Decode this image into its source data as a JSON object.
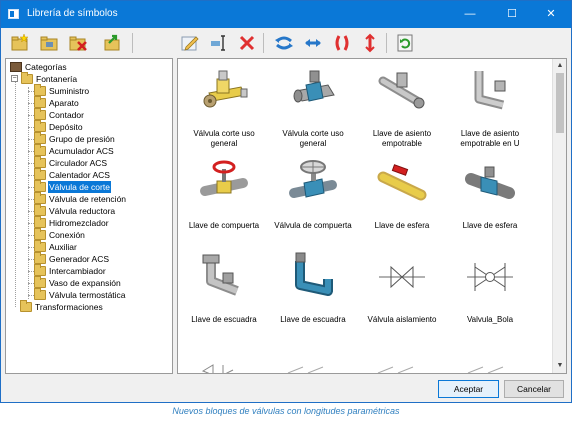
{
  "window": {
    "title": "Librería de símbolos",
    "controls": {
      "minimize": "—",
      "maximize": "☐",
      "close": "✕"
    }
  },
  "toolbar": {
    "buttons": [
      "new-folder-icon",
      "folder-icon",
      "delete-folder-icon",
      "export-icon",
      "edit-icon",
      "rename-icon",
      "delete-icon",
      "rotate-left-icon",
      "rotate-right-icon",
      "flip-vertical-icon",
      "flip-horizontal-icon",
      "refresh-icon"
    ]
  },
  "tree": {
    "root": "Categorías",
    "group": "Fontanería",
    "items": [
      "Suministro",
      "Aparato",
      "Contador",
      "Depósito",
      "Grupo de presión",
      "Acumulador ACS",
      "Circulador ACS",
      "Calentador ACS",
      "Válvula de corte",
      "Válvula de retención",
      "Válvula reductora",
      "Hidromezclador",
      "Conexión",
      "Auxiliar",
      "Generador ACS",
      "Intercambiador",
      "Vaso de expansión",
      "Válvula termostática"
    ],
    "selected": "Válvula de corte",
    "other": "Transformaciones"
  },
  "symbols": [
    {
      "label": "Válvula corte uso general",
      "icon": "gate-valve-yellow-icon"
    },
    {
      "label": "Válvula corte uso general",
      "icon": "gate-valve-blue-icon"
    },
    {
      "label": "Llave de asiento empotrable",
      "icon": "recessed-valve-icon"
    },
    {
      "label": "Llave de asiento empotrable en U",
      "icon": "recessed-valve-u-icon"
    },
    {
      "label": "Llave de compuerta",
      "icon": "gate-valve-red-wheel-icon"
    },
    {
      "label": "Válvula de compuerta",
      "icon": "gate-valve-handwheel-icon"
    },
    {
      "label": "Llave de esfera",
      "icon": "ball-valve-yellow-icon"
    },
    {
      "label": "Llave de esfera",
      "icon": "ball-valve-blue-icon"
    },
    {
      "label": "Llave de escuadra",
      "icon": "angle-valve-grey-icon"
    },
    {
      "label": "Llave de escuadra",
      "icon": "angle-valve-blue-icon"
    },
    {
      "label": "Válvula aislamiento",
      "icon": "isolation-valve-symbol-icon"
    },
    {
      "label": "Valvula_Bola",
      "icon": "ball-valve-symbol-icon"
    }
  ],
  "buttons": {
    "accept": "Aceptar",
    "cancel": "Cancelar"
  },
  "caption": "Nuevos bloques de válvulas con longitudes paramétricas",
  "colors": {
    "titlebar": "#0a78d7",
    "selection": "#0a78d7",
    "caption": "#2f7fbf",
    "valve_yellow": "#e8cc4a",
    "valve_blue": "#3a8fb7",
    "valve_grey": "#a8a8a8"
  }
}
